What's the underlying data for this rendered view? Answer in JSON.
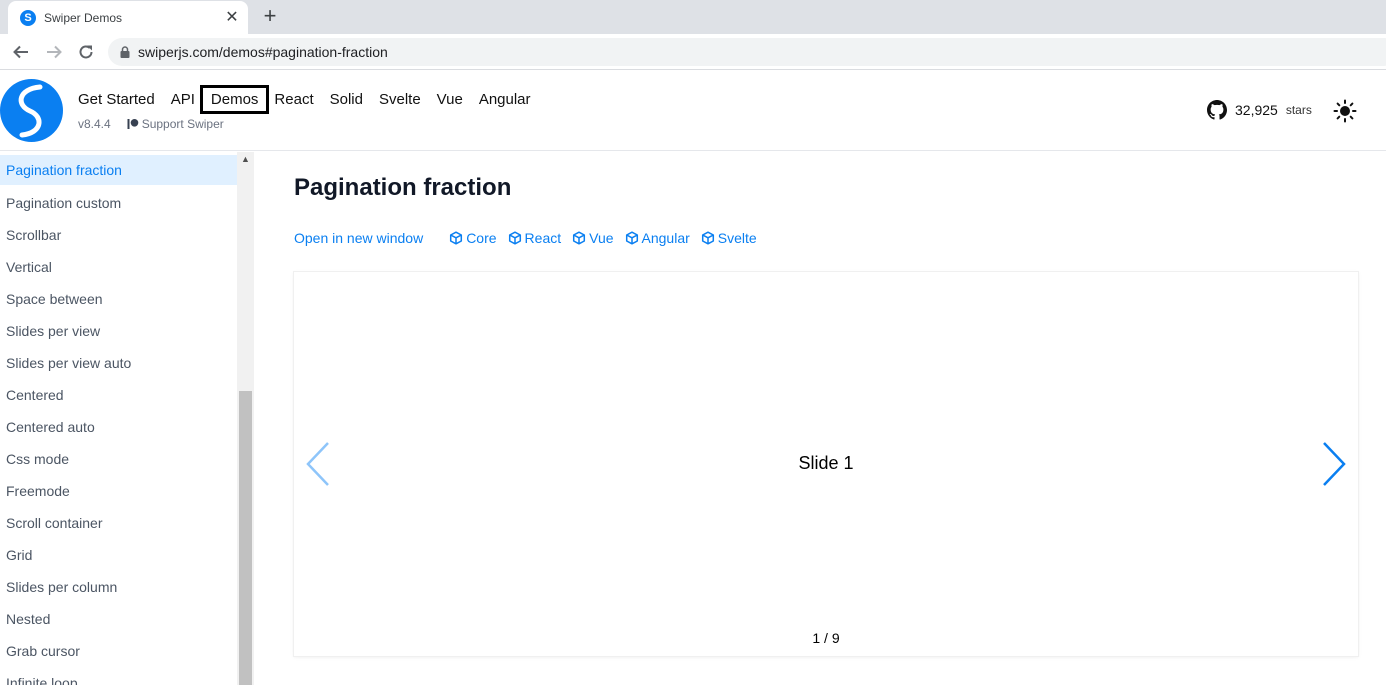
{
  "browser": {
    "tab_title": "Swiper Demos",
    "tab_favicon_letter": "S",
    "close_glyph": "✕",
    "newtab_glyph": "+",
    "url": "swiperjs.com/demos#pagination-fraction"
  },
  "header": {
    "nav": [
      "Get Started",
      "API",
      "Demos",
      "React",
      "Solid",
      "Svelte",
      "Vue",
      "Angular"
    ],
    "active_nav": "Demos",
    "version": "v8.4.4",
    "support_label": "Support Swiper",
    "github_count": "32,925",
    "github_suffix": "stars"
  },
  "sidebar": {
    "items": [
      "Pagination fraction",
      "Pagination custom",
      "Scrollbar",
      "Vertical",
      "Space between",
      "Slides per view",
      "Slides per view auto",
      "Centered",
      "Centered auto",
      "Css mode",
      "Freemode",
      "Scroll container",
      "Grid",
      "Slides per column",
      "Nested",
      "Grab cursor",
      "Infinite loop"
    ],
    "active_index": 0
  },
  "main": {
    "title": "Pagination fraction",
    "open_label": "Open in new window",
    "frameworks": [
      "Core",
      "React",
      "Vue",
      "Angular",
      "Svelte"
    ],
    "slide_label": "Slide 1",
    "pagination": "1 / 9"
  },
  "colors": {
    "accent": "#0a7ff1",
    "accent_faded": "#8ec5fa",
    "active_bg": "#e0f0ff"
  },
  "icons": {
    "tab": "swiper-logo-icon",
    "back": "arrow-left-icon",
    "forward": "arrow-right-icon",
    "reload": "reload-icon",
    "lock": "lock-icon",
    "github": "github-icon",
    "theme": "sun-icon",
    "framework": "cube-icon",
    "prev": "chevron-left-icon",
    "next": "chevron-right-icon"
  }
}
